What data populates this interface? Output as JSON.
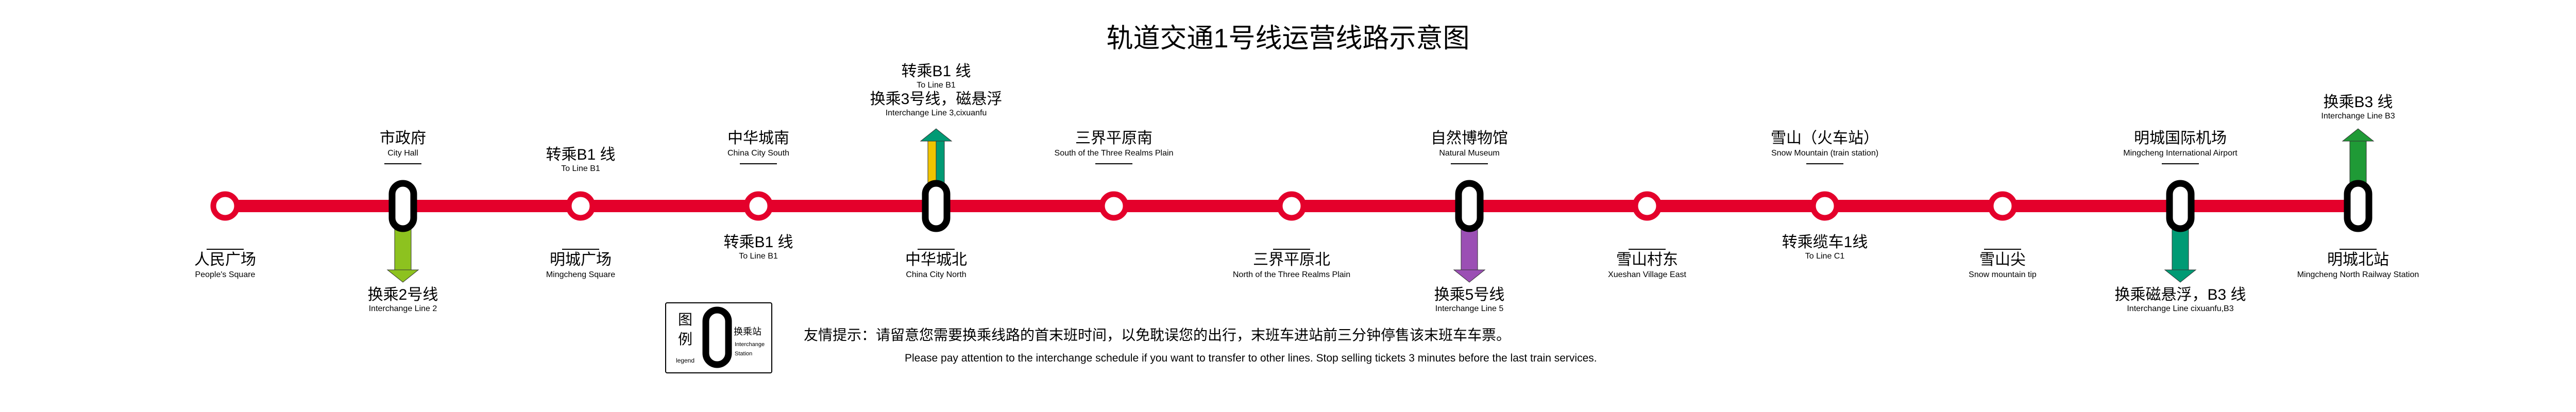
{
  "title": "轨道交通1号线运营线路示意图",
  "colors": {
    "line": "#e4002b",
    "interchange_border": "#000000",
    "line_2": "#8dc21f",
    "line_3": "#f0c400",
    "maglev": "#009a74",
    "line_5": "#9b4fb4",
    "line_b3": "#1f9a36"
  },
  "stations": [
    {
      "name": "人民广场",
      "en": "People's Square",
      "pos": "below",
      "interchange": false
    },
    {
      "name": "市政府",
      "en": "City Hall",
      "pos": "above",
      "interchange": true
    },
    {
      "name": "明城广场",
      "en": "Mingcheng Square",
      "pos": "below",
      "interchange": false
    },
    {
      "name": "中华城南",
      "en": "China City South",
      "pos": "above",
      "interchange": false
    },
    {
      "name": "中华城北",
      "en": "China City North",
      "pos": "below",
      "interchange": true
    },
    {
      "name": "三界平原南",
      "en": "South of the Three Realms Plain",
      "pos": "above",
      "interchange": false
    },
    {
      "name": "三界平原北",
      "en": "North of the Three Realms Plain",
      "pos": "below",
      "interchange": false
    },
    {
      "name": "自然博物馆",
      "en": "Natural Museum",
      "pos": "above",
      "interchange": true
    },
    {
      "name": "雪山村东",
      "en": "Xueshan Village East",
      "pos": "below",
      "interchange": false
    },
    {
      "name": "雪山（火车站）",
      "en": "Snow Mountain (train station)",
      "pos": "above",
      "interchange": false
    },
    {
      "name": "雪山尖",
      "en": "Snow mountain tip",
      "pos": "below",
      "interchange": false
    },
    {
      "name": "明城国际机场",
      "en": "Mingcheng International Airport",
      "pos": "above",
      "interchange": true
    },
    {
      "name": "明城北站",
      "en": "Mingcheng North Railway Station",
      "pos": "below",
      "interchange": true
    }
  ],
  "transfer_labels": [
    {
      "station": 1,
      "pos": "below",
      "lines": [
        {
          "zh": "换乘2号线",
          "en": "Interchange Line 2"
        }
      ]
    },
    {
      "station": 2,
      "pos": "above",
      "lines": [
        {
          "zh": "转乘B1 线",
          "en": "To Line B1"
        }
      ]
    },
    {
      "station": 3,
      "pos": "below",
      "lines": [
        {
          "zh": "转乘B1 线",
          "en": "To Line B1"
        }
      ]
    },
    {
      "station": 4,
      "pos": "above",
      "lines": [
        {
          "zh": "转乘B1 线",
          "en": "To Line B1"
        },
        {
          "zh": "换乘3号线，磁悬浮",
          "en": "Interchange Line 3,cixuanfu"
        }
      ]
    },
    {
      "station": 7,
      "pos": "below",
      "lines": [
        {
          "zh": "换乘5号线",
          "en": "Interchange Line 5"
        }
      ]
    },
    {
      "station": 9,
      "pos": "below",
      "lines": [
        {
          "zh": "转乘缆车1线",
          "en": "To Line C1"
        }
      ]
    },
    {
      "station": 11,
      "pos": "below",
      "lines": [
        {
          "zh": "换乘磁悬浮，B3 线",
          "en": "Interchange Line cixuanfu,B3"
        }
      ]
    },
    {
      "station": 12,
      "pos": "above",
      "lines": [
        {
          "zh": "换乘B3 线",
          "en": "Interchange Line B3"
        }
      ]
    }
  ],
  "legend": {
    "title_chars": [
      "图",
      "例"
    ],
    "title_en": "legend",
    "label_zh": "换乘站",
    "label_en_1": "Interchange",
    "label_en_2": "Station"
  },
  "notice": {
    "zh": "友情提示：请留意您需要换乘线路的首末班时间，以免耽误您的出行，末班车进站前三分钟停售该末班车车票。",
    "en": "Please pay attention to the interchange schedule if you want to transfer to other lines. Stop selling tickets 3 minutes before the last train services."
  }
}
